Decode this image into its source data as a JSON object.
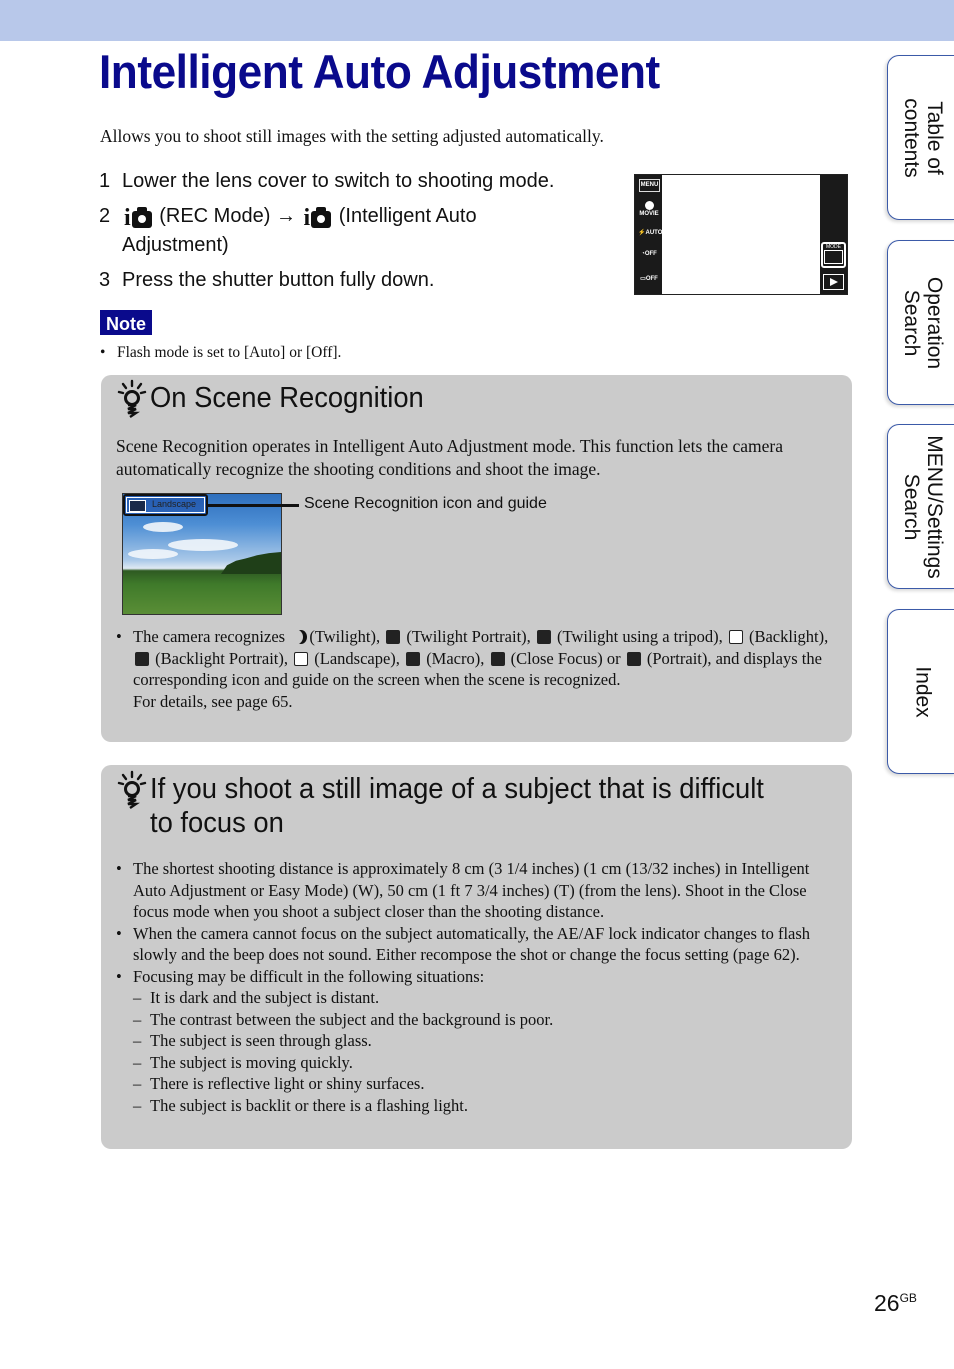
{
  "page": {
    "title": "Intelligent Auto Adjustment",
    "intro": "Allows you to shoot still images with the setting adjusted automatically.",
    "steps": [
      {
        "num": "1",
        "text": "Lower the lens cover to switch to shooting mode."
      },
      {
        "num": "2",
        "part1": "(REC Mode)",
        "arrow": "→",
        "part2": "(Intelligent Auto",
        "part3": "Adjustment)"
      },
      {
        "num": "3",
        "text": "Press the shutter button fully down."
      }
    ],
    "camera_screen": {
      "left_buttons": [
        "MENU",
        "MOVIE",
        "AUTO",
        "OFF",
        "OFF"
      ],
      "mode_label": "MODE"
    },
    "note": {
      "label": "Note",
      "items": [
        "Flash mode is set to [Auto] or [Off]."
      ]
    },
    "page_number": "26",
    "page_suffix": "GB"
  },
  "scene_box": {
    "title": "On Scene Recognition",
    "paragraph": "Scene Recognition operates in Intelligent Auto Adjustment mode. This function lets the camera automatically recognize the shooting conditions and shoot the image.",
    "image_tag": "Landscape",
    "callout": "Scene Recognition icon and guide",
    "bullet_parts": {
      "p1": "The camera recognizes",
      "twilight": "(Twilight),",
      "twilight_portrait": "(Twilight Portrait),",
      "twilight_tripod": "(Twilight using a tripod),",
      "backlight": "(Backlight),",
      "backlight_portrait": "(Backlight Portrait),",
      "landscape": "(Landscape),",
      "macro": "(Macro),",
      "close_focus": "(Close Focus) or",
      "portrait": "(Portrait), and displays the corresponding icon and guide on the screen when the scene is recognized.",
      "details": "For details, see page 65."
    }
  },
  "focus_box": {
    "title_line1": "If you shoot a still image of a subject that is difficult",
    "title_line2": "to focus on",
    "bullets": [
      "The shortest shooting distance is approximately 8 cm (3 1/4 inches) (1 cm (13/32 inches) in Intelligent Auto Adjustment or Easy Mode) (W), 50 cm (1 ft 7 3/4 inches) (T) (from the lens). Shoot in the Close focus mode when you shoot a subject closer than the shooting distance.",
      "When the camera cannot focus on the subject automatically, the AE/AF lock indicator changes to flash slowly and the beep does not sound. Either recompose the shot or change the focus setting (page 62).",
      "Focusing may be difficult in the following situations:"
    ],
    "situations": [
      "It is dark and the subject is distant.",
      "The contrast between the subject and the background is poor.",
      "The subject is seen through glass.",
      "The subject is moving quickly.",
      "There is reflective light or shiny surfaces.",
      "The subject is backlit or there is a flashing light."
    ]
  },
  "side_tabs": [
    {
      "line1": "Table of",
      "line2": "contents"
    },
    {
      "line1": "Operation",
      "line2": "Search"
    },
    {
      "line1": "MENU/Settings",
      "line2": "Search"
    },
    {
      "line1": "Index",
      "line2": ""
    }
  ],
  "colors": {
    "title_blue": "#0a0a8c",
    "header_band": "#b8c8ea",
    "box_gray": "#cbcbcb",
    "tab_border": "#3b5aa8"
  }
}
